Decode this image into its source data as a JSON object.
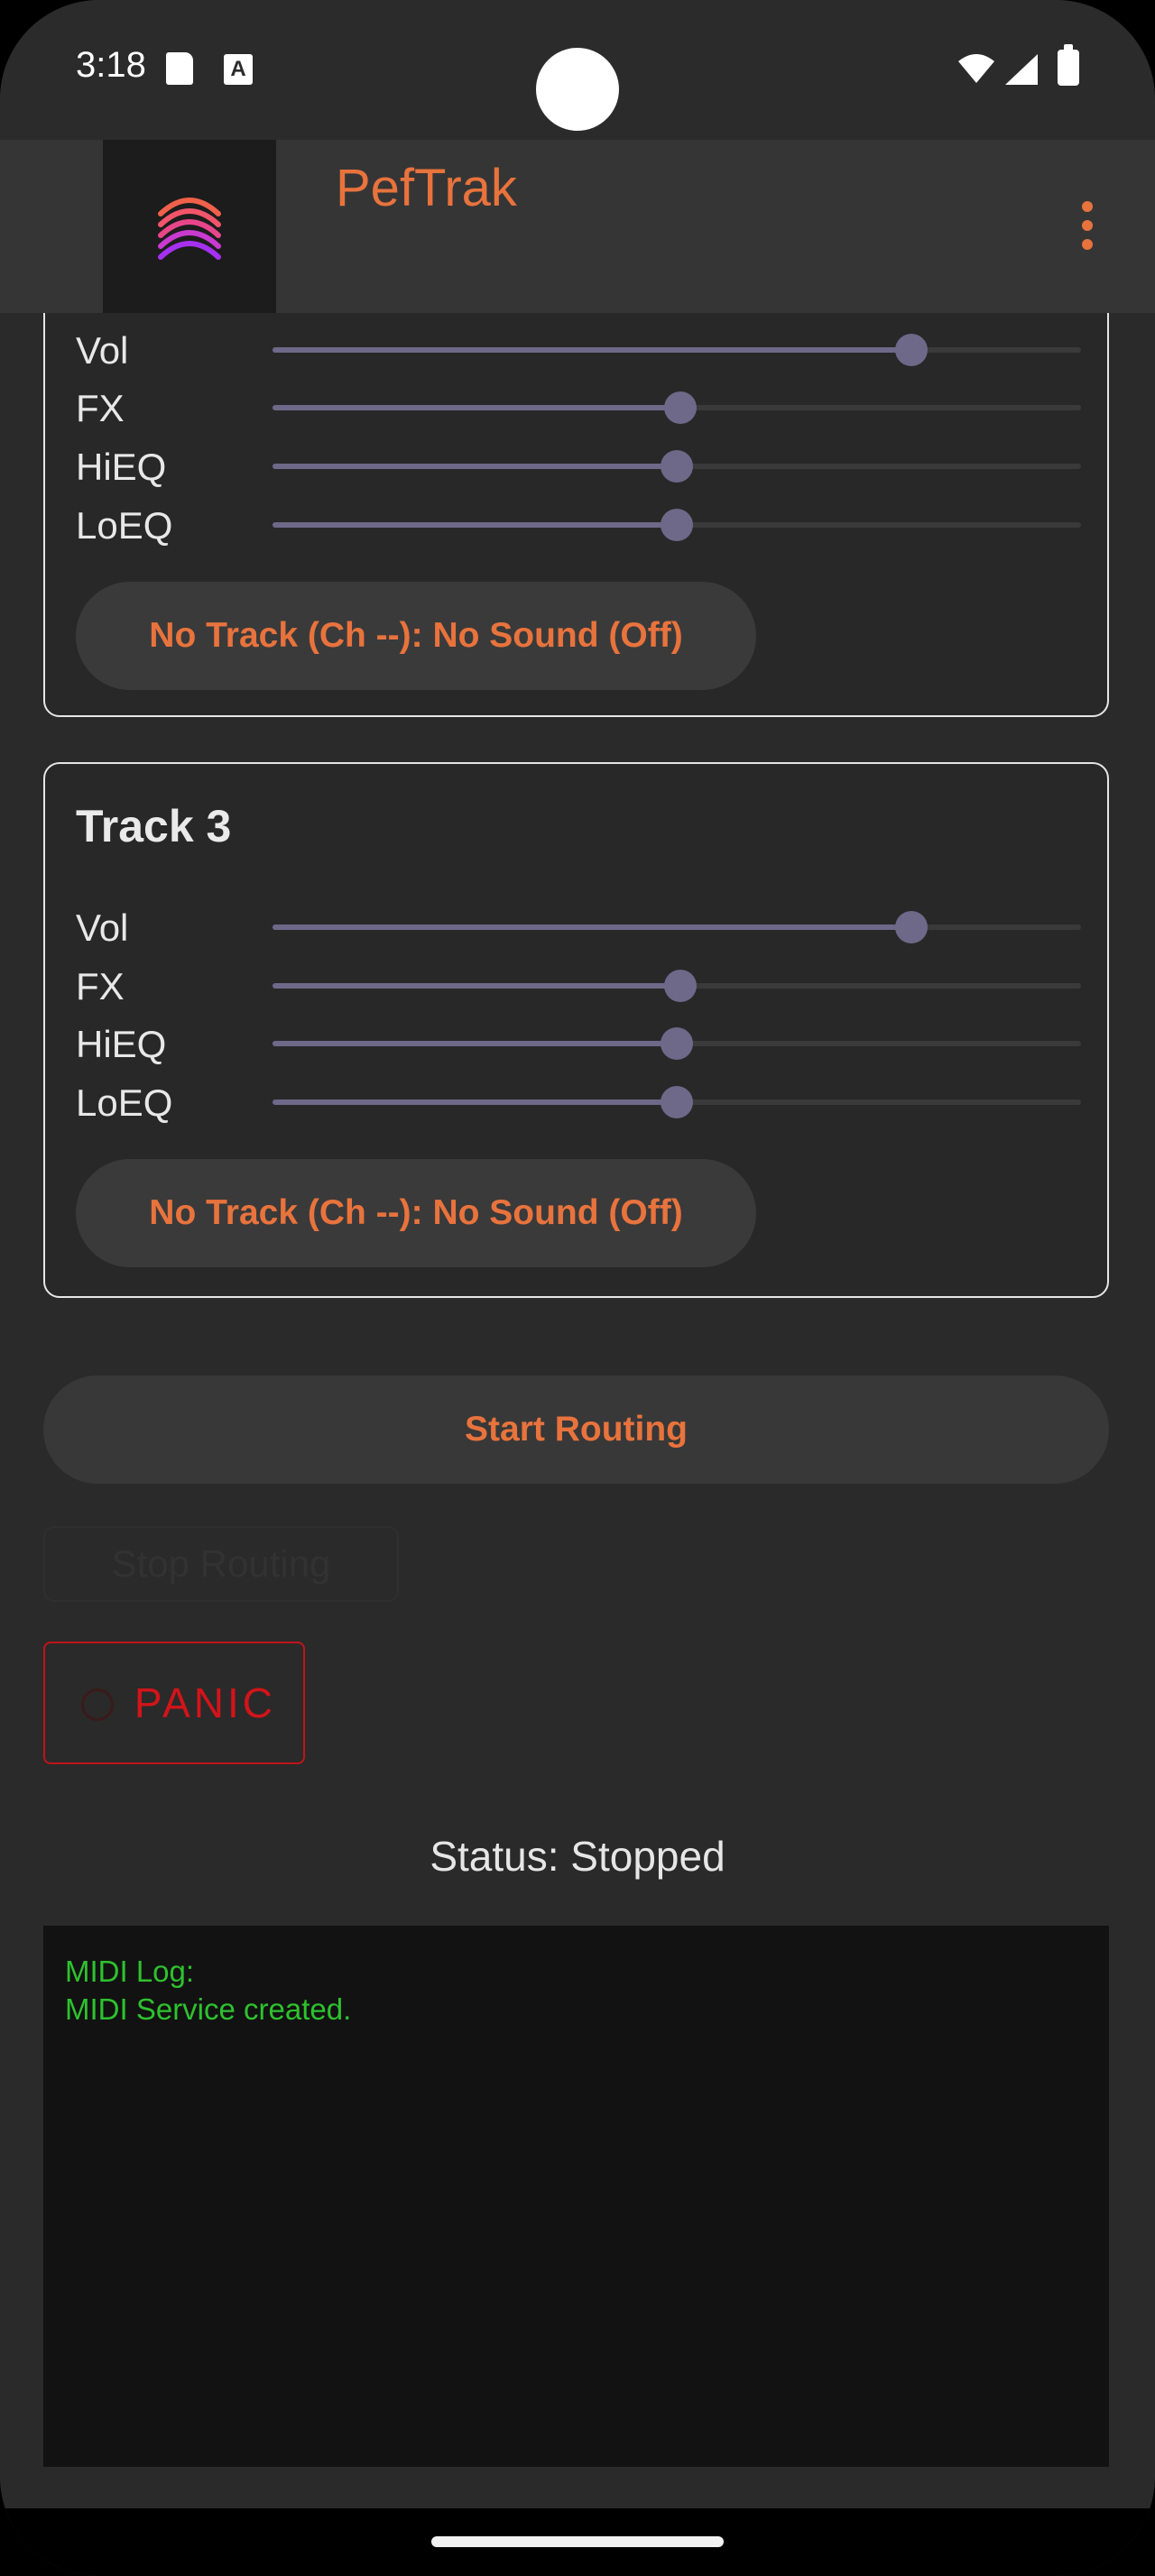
{
  "status_bar": {
    "time": "3:18"
  },
  "app_bar": {
    "title": "PefTrak",
    "menu_icon": "more-vert-icon",
    "logo_icon": "waves-logo"
  },
  "tracks": [
    {
      "title": "",
      "sliders": [
        {
          "label": "Vol",
          "value": 0.79
        },
        {
          "label": "FX",
          "value": 0.505
        },
        {
          "label": "HiEQ",
          "value": 0.5
        },
        {
          "label": "LoEQ",
          "value": 0.5
        }
      ],
      "assign_label": "No Track (Ch --): No Sound (Off)"
    },
    {
      "title": "Track 3",
      "sliders": [
        {
          "label": "Vol",
          "value": 0.79
        },
        {
          "label": "FX",
          "value": 0.505
        },
        {
          "label": "HiEQ",
          "value": 0.5
        },
        {
          "label": "LoEQ",
          "value": 0.5
        }
      ],
      "assign_label": "No Track (Ch --): No Sound (Off)"
    }
  ],
  "buttons": {
    "start_routing": "Start Routing",
    "stop_routing": "Stop Routing",
    "panic": "PANIC"
  },
  "status_text": "Status: Stopped",
  "log": {
    "lines": [
      "MIDI Log:",
      "MIDI Service created."
    ]
  },
  "colors": {
    "accent": "#e8733d",
    "panic": "#d2141a",
    "log_text": "#2ec22e",
    "slider": "#6e6889"
  }
}
